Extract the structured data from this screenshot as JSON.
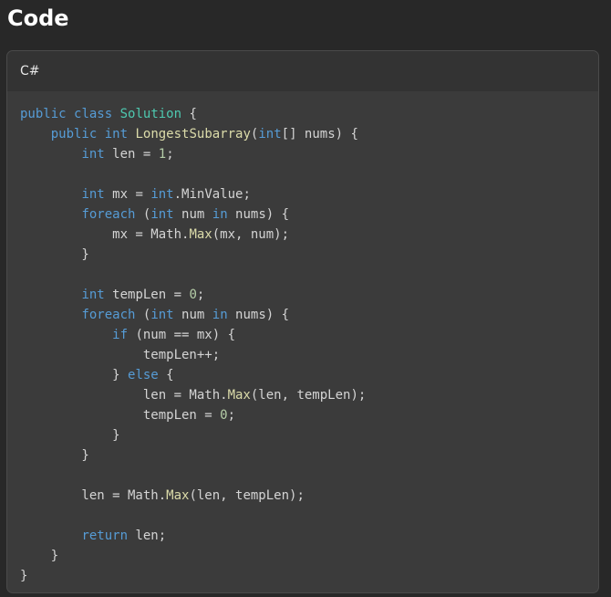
{
  "page": {
    "title": "Code"
  },
  "code_block": {
    "language": "C#",
    "lines": [
      [
        {
          "t": "public",
          "c": "keyword"
        },
        {
          "t": " "
        },
        {
          "t": "class",
          "c": "keyword"
        },
        {
          "t": " "
        },
        {
          "t": "Solution",
          "c": "type"
        },
        {
          "t": " {"
        }
      ],
      [
        {
          "t": "    "
        },
        {
          "t": "public",
          "c": "keyword"
        },
        {
          "t": " "
        },
        {
          "t": "int",
          "c": "keyword"
        },
        {
          "t": " "
        },
        {
          "t": "LongestSubarray",
          "c": "func"
        },
        {
          "t": "("
        },
        {
          "t": "int",
          "c": "keyword"
        },
        {
          "t": "[] nums) {"
        }
      ],
      [
        {
          "t": "        "
        },
        {
          "t": "int",
          "c": "keyword"
        },
        {
          "t": " len = "
        },
        {
          "t": "1",
          "c": "number"
        },
        {
          "t": ";"
        }
      ],
      [],
      [
        {
          "t": "        "
        },
        {
          "t": "int",
          "c": "keyword"
        },
        {
          "t": " mx = "
        },
        {
          "t": "int",
          "c": "keyword"
        },
        {
          "t": ".MinValue;"
        }
      ],
      [
        {
          "t": "        "
        },
        {
          "t": "foreach",
          "c": "keyword"
        },
        {
          "t": " ("
        },
        {
          "t": "int",
          "c": "keyword"
        },
        {
          "t": " num "
        },
        {
          "t": "in",
          "c": "keyword"
        },
        {
          "t": " nums) {"
        }
      ],
      [
        {
          "t": "            mx = Math."
        },
        {
          "t": "Max",
          "c": "func"
        },
        {
          "t": "(mx, num);"
        }
      ],
      [
        {
          "t": "        }"
        }
      ],
      [],
      [
        {
          "t": "        "
        },
        {
          "t": "int",
          "c": "keyword"
        },
        {
          "t": " tempLen = "
        },
        {
          "t": "0",
          "c": "number"
        },
        {
          "t": ";"
        }
      ],
      [
        {
          "t": "        "
        },
        {
          "t": "foreach",
          "c": "keyword"
        },
        {
          "t": " ("
        },
        {
          "t": "int",
          "c": "keyword"
        },
        {
          "t": " num "
        },
        {
          "t": "in",
          "c": "keyword"
        },
        {
          "t": " nums) {"
        }
      ],
      [
        {
          "t": "            "
        },
        {
          "t": "if",
          "c": "keyword"
        },
        {
          "t": " (num == mx) {"
        }
      ],
      [
        {
          "t": "                tempLen++;"
        }
      ],
      [
        {
          "t": "            } "
        },
        {
          "t": "else",
          "c": "keyword"
        },
        {
          "t": " {"
        }
      ],
      [
        {
          "t": "                len = Math."
        },
        {
          "t": "Max",
          "c": "func"
        },
        {
          "t": "(len, tempLen);"
        }
      ],
      [
        {
          "t": "                tempLen = "
        },
        {
          "t": "0",
          "c": "number"
        },
        {
          "t": ";"
        }
      ],
      [
        {
          "t": "            }"
        }
      ],
      [
        {
          "t": "        }"
        }
      ],
      [],
      [
        {
          "t": "        len = Math."
        },
        {
          "t": "Max",
          "c": "func"
        },
        {
          "t": "(len, tempLen);"
        }
      ],
      [],
      [
        {
          "t": "        "
        },
        {
          "t": "return",
          "c": "keyword"
        },
        {
          "t": " len;"
        }
      ],
      [
        {
          "t": "    }"
        }
      ],
      [
        {
          "t": "}"
        }
      ]
    ]
  },
  "colors": {
    "page_background": "#282828",
    "card_background": "#3b3b3b",
    "header_background": "#333333",
    "keyword": "#569cd6",
    "type": "#4ec9b0",
    "function": "#dcdcaa",
    "number": "#b5cea8",
    "plain": "#d4d4d4"
  }
}
